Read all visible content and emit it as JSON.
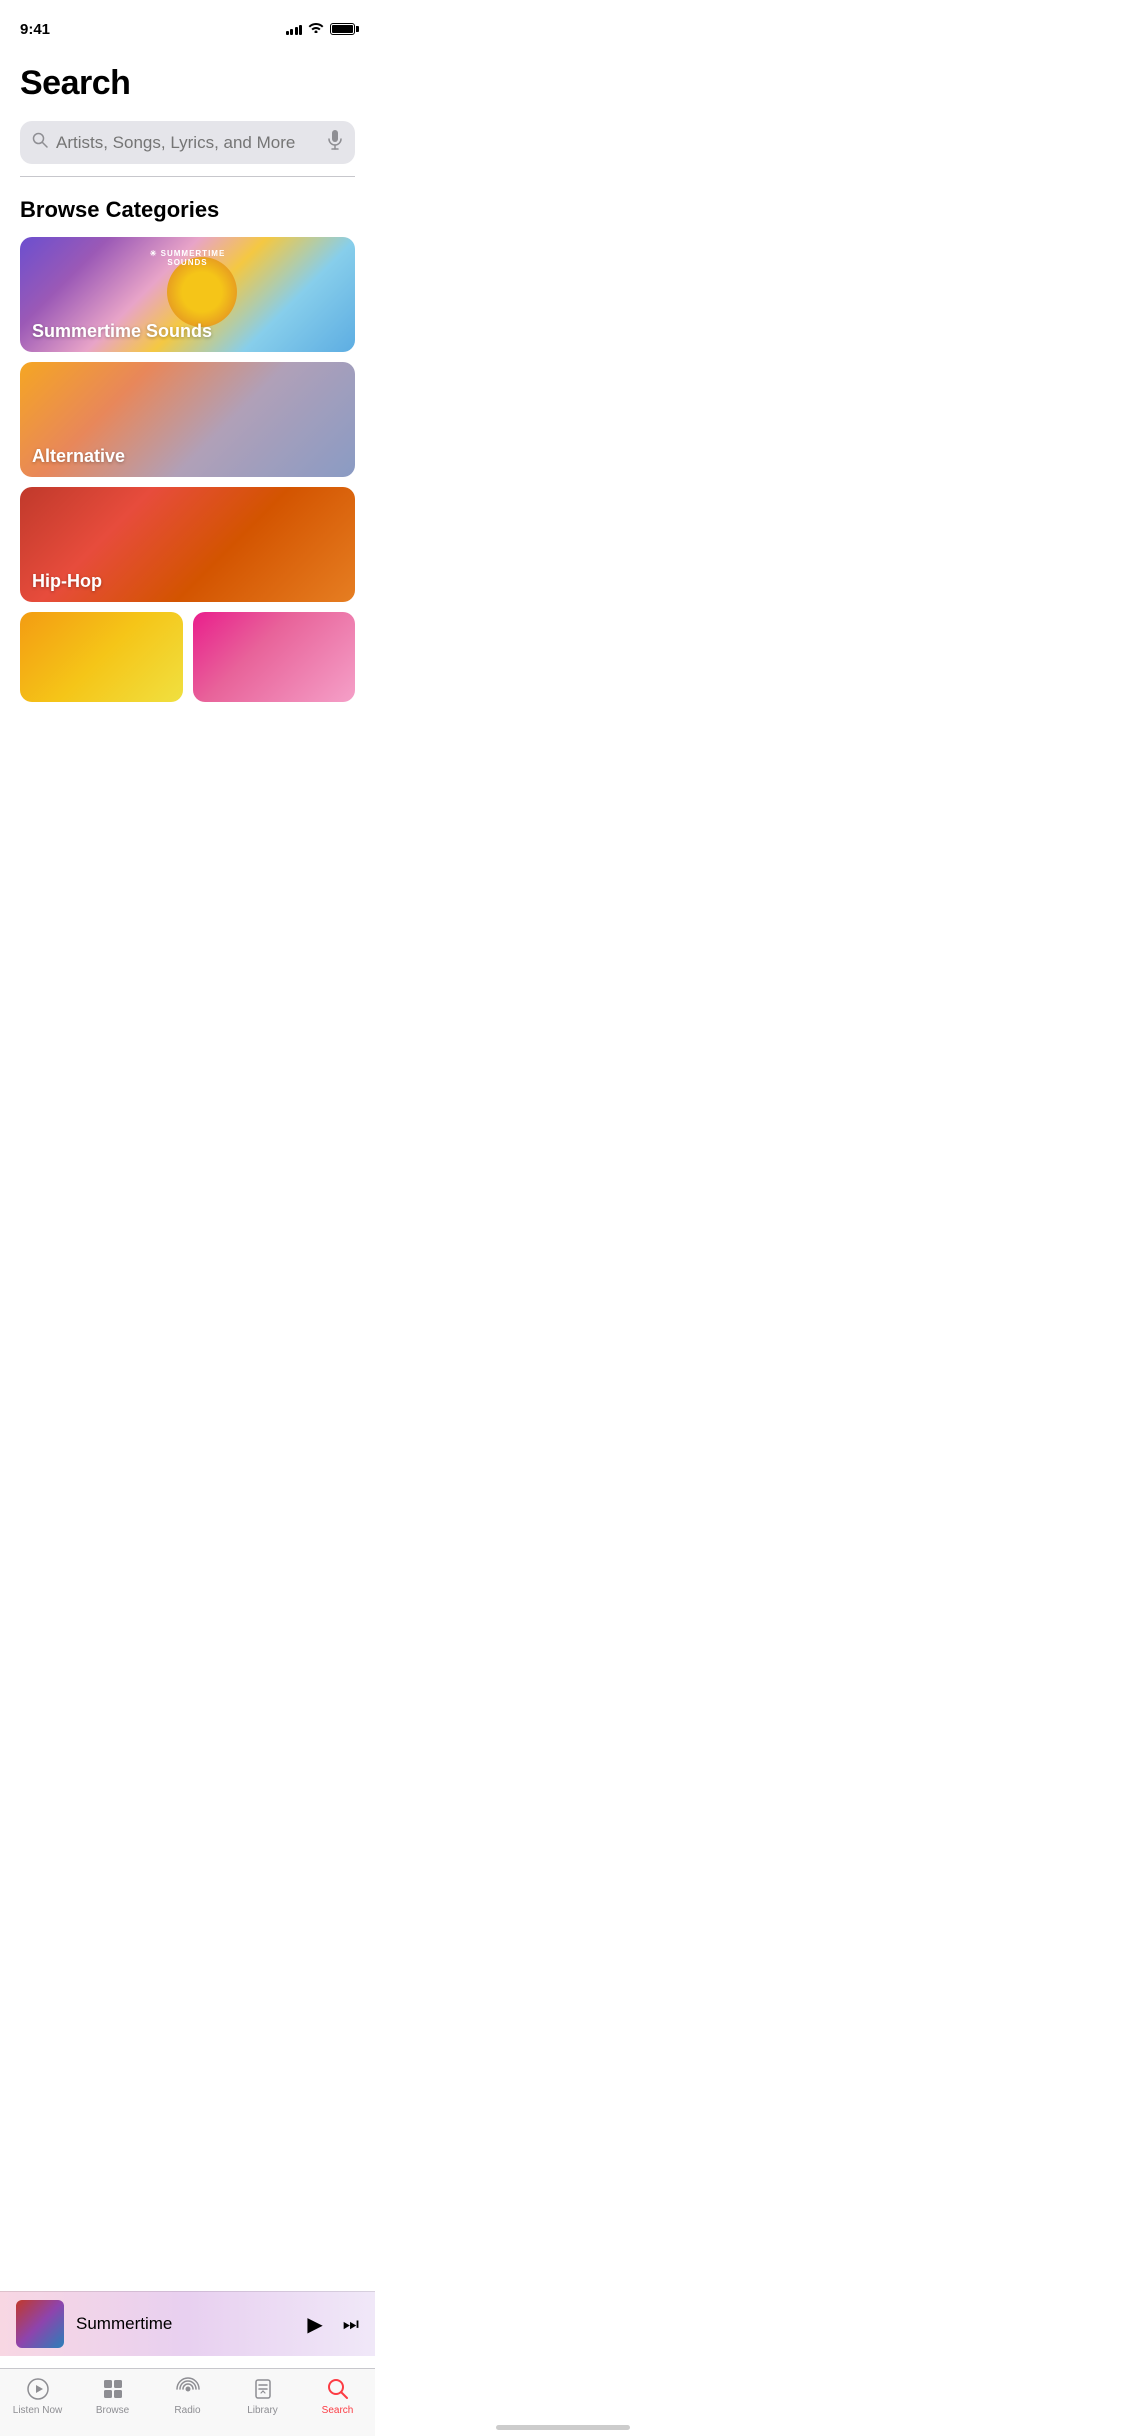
{
  "statusBar": {
    "time": "9:41",
    "signalBars": [
      4,
      6,
      8,
      10,
      12
    ],
    "battery": 90
  },
  "header": {
    "title": "Search"
  },
  "searchBar": {
    "placeholder": "Artists, Songs, Lyrics, and More"
  },
  "browseSection": {
    "title": "Browse Categories"
  },
  "categories": [
    {
      "id": "summertime-sounds",
      "label": "Summertime Sounds",
      "bgClass": "bg-summertime",
      "type": "full",
      "hasLogo": true,
      "logoText": "SUMMERTIME SOUNDS"
    },
    {
      "id": "alternative",
      "label": "Alternative",
      "bgClass": "bg-alternative",
      "type": "full"
    },
    {
      "id": "hip-hop",
      "label": "Hip-Hop",
      "bgClass": "bg-hiphop",
      "type": "full"
    },
    {
      "id": "yellow-category",
      "label": "",
      "bgClass": "bg-yellow",
      "type": "half"
    },
    {
      "id": "pink-category",
      "label": "",
      "bgClass": "bg-pink",
      "type": "half"
    }
  ],
  "miniPlayer": {
    "title": "Summertime",
    "playing": true
  },
  "tabBar": {
    "items": [
      {
        "id": "listen-now",
        "label": "Listen Now",
        "icon": "listen-now",
        "active": false
      },
      {
        "id": "browse",
        "label": "Browse",
        "icon": "browse",
        "active": false
      },
      {
        "id": "radio",
        "label": "Radio",
        "icon": "radio",
        "active": false
      },
      {
        "id": "library",
        "label": "Library",
        "icon": "library",
        "active": false
      },
      {
        "id": "search",
        "label": "Search",
        "icon": "search",
        "active": true
      }
    ]
  }
}
